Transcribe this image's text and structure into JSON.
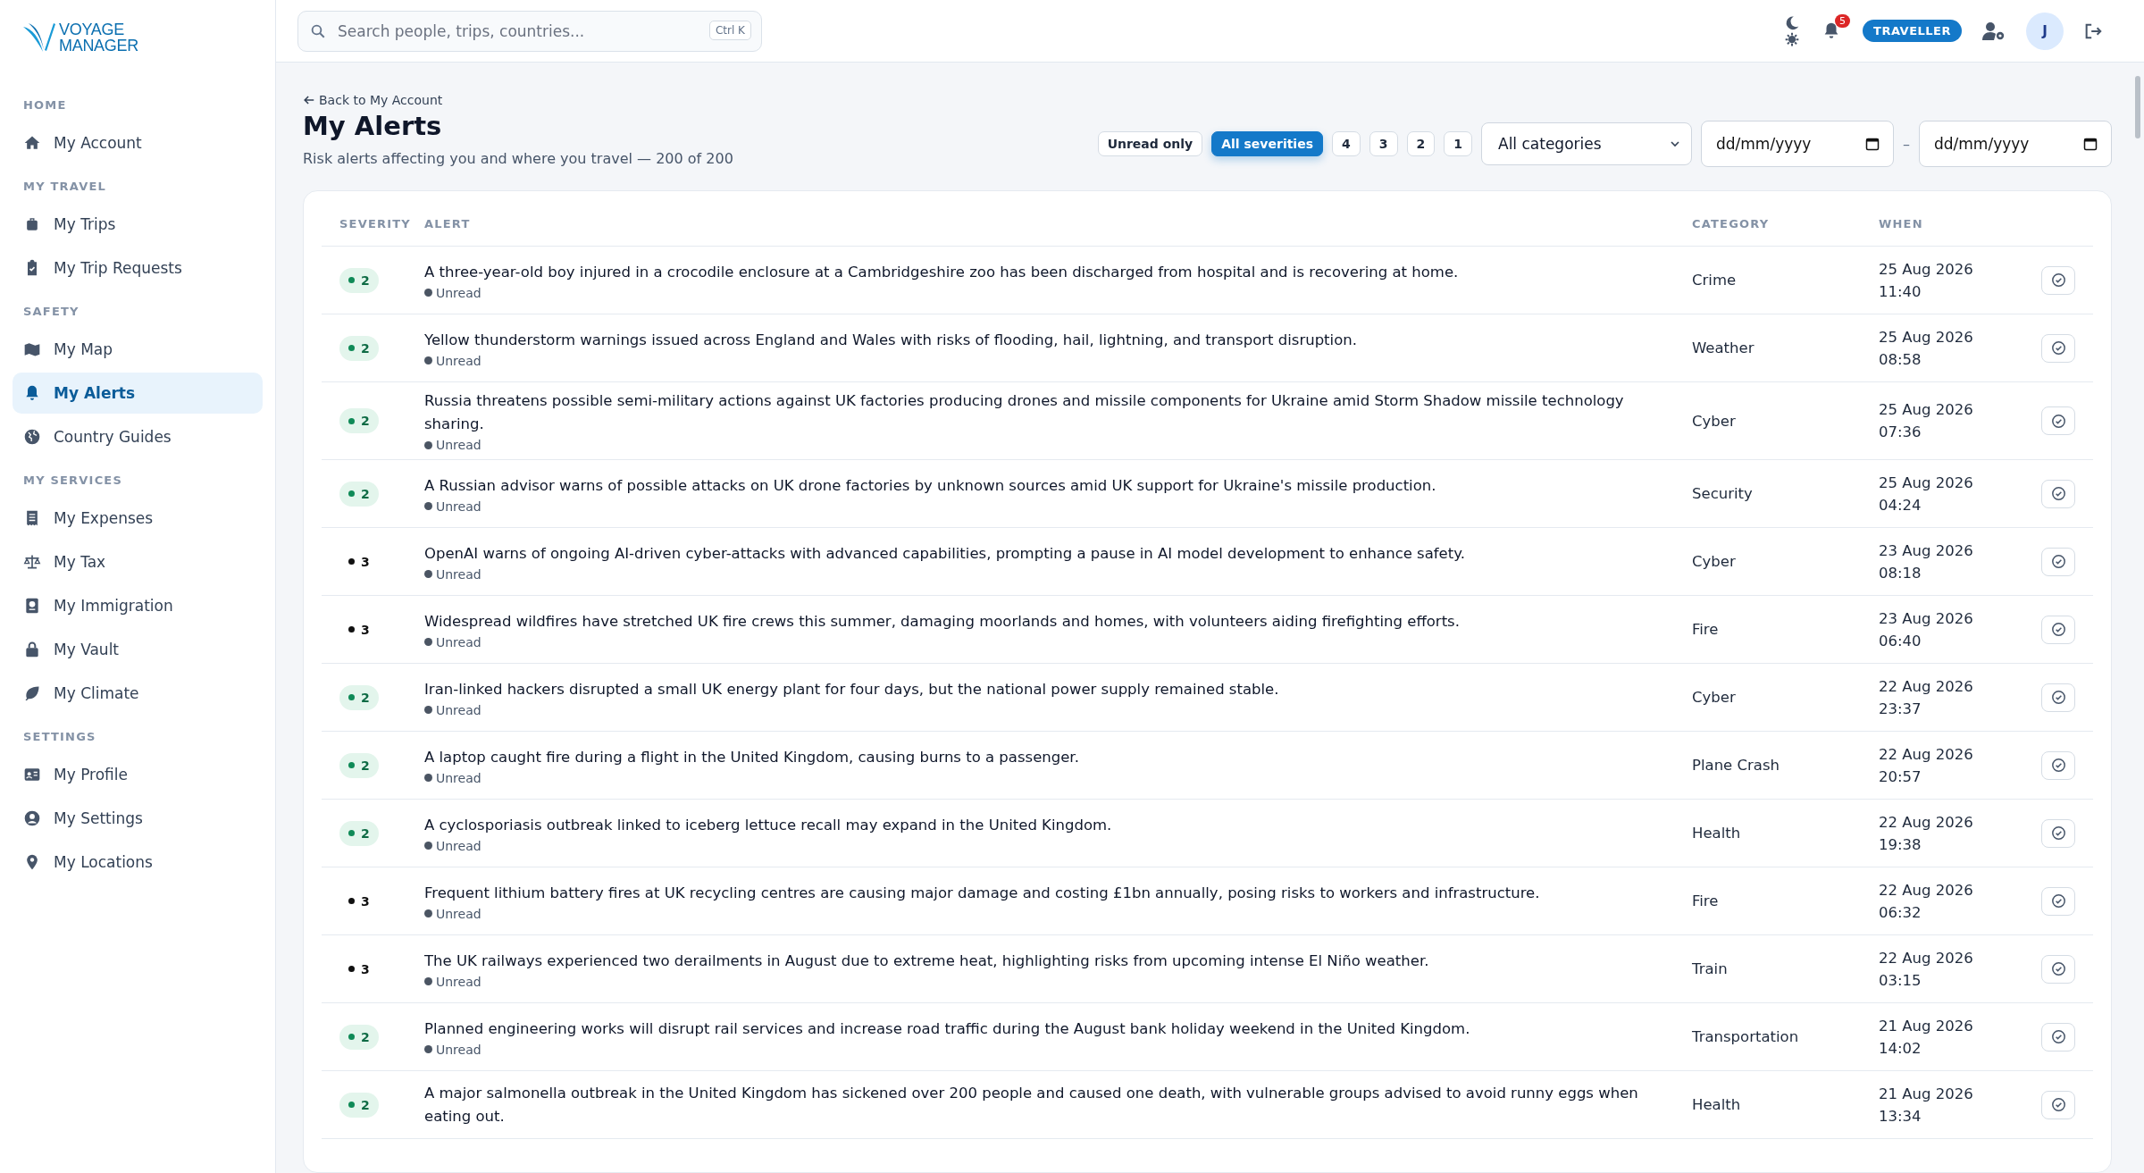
{
  "logo": {
    "line_1": "VOYAGE",
    "line_2": "MANAGER"
  },
  "sidebar": {
    "sections": [
      {
        "heading": "HOME",
        "items": [
          {
            "label": "My Account",
            "selected": false
          }
        ]
      },
      {
        "heading": "MY TRAVEL",
        "items": [
          {
            "label": "My Trips",
            "selected": false
          },
          {
            "label": "My Trip Requests",
            "selected": false
          }
        ]
      },
      {
        "heading": "SAFETY",
        "items": [
          {
            "label": "My Map",
            "selected": false
          },
          {
            "label": "My Alerts",
            "selected": true
          },
          {
            "label": "Country Guides",
            "selected": false
          }
        ]
      },
      {
        "heading": "MY SERVICES",
        "items": [
          {
            "label": "My Expenses",
            "selected": false
          },
          {
            "label": "My Tax",
            "selected": false
          },
          {
            "label": "My Immigration",
            "selected": false
          },
          {
            "label": "My Vault",
            "selected": false
          },
          {
            "label": "My Climate",
            "selected": false
          }
        ]
      },
      {
        "heading": "SETTINGS",
        "items": [
          {
            "label": "My Profile",
            "selected": false
          },
          {
            "label": "My Settings",
            "selected": false
          },
          {
            "label": "My Locations",
            "selected": false
          }
        ]
      }
    ]
  },
  "topbar": {
    "search": {
      "placeholder": "Search people, trips, countries...",
      "shortcut": "Ctrl K"
    },
    "notification_count": "5",
    "role_badge": "TRAVELLER",
    "avatar": "J"
  },
  "header": {
    "back_link": "Back to My Account",
    "title": "My Alerts",
    "subtitle": "Risk alerts affecting you and where you travel — 200 of 200"
  },
  "filters": {
    "chips": [
      {
        "label": "Unread only",
        "selected": false
      },
      {
        "label": "All severities",
        "selected": true
      },
      {
        "label": "4",
        "selected": false
      },
      {
        "label": "3",
        "selected": false
      },
      {
        "label": "2",
        "selected": false
      },
      {
        "label": "1",
        "selected": false
      }
    ],
    "category": "All categories",
    "date_from": {
      "placeholder": "dd/mm/yyyy"
    },
    "date_separator": "–",
    "date_to": {
      "placeholder": "dd/mm/yyyy"
    }
  },
  "table": {
    "columns": [
      "SEVERITY",
      "ALERT",
      "CATEGORY",
      "WHEN"
    ],
    "rows": [
      {
        "severity": "2",
        "kind": "pill",
        "alert": "A three-year-old boy injured in a crocodile enclosure at a Cambridgeshire zoo has been discharged from hospital and is recovering at home.",
        "status": "Unread",
        "category": "Crime",
        "when": "25 Aug 2026 11:40"
      },
      {
        "severity": "2",
        "kind": "pill",
        "alert": "Yellow thunderstorm warnings issued across England and Wales with risks of flooding, hail, lightning, and transport disruption.",
        "status": "Unread",
        "category": "Weather",
        "when": "25 Aug 2026 08:58"
      },
      {
        "severity": "2",
        "kind": "pill",
        "alert": "Russia threatens possible semi-military actions against UK factories producing drones and missile components for Ukraine amid Storm Shadow missile technology sharing.",
        "status": "Unread",
        "category": "Cyber",
        "when": "25 Aug 2026 07:36"
      },
      {
        "severity": "2",
        "kind": "pill",
        "alert": "A Russian advisor warns of possible attacks on UK drone factories by unknown sources amid UK support for Ukraine's missile production.",
        "status": "Unread",
        "category": "Security",
        "when": "25 Aug 2026 04:24"
      },
      {
        "severity": "3",
        "kind": "plain",
        "alert": "OpenAI warns of ongoing AI-driven cyber-attacks with advanced capabilities, prompting a pause in AI model development to enhance safety.",
        "status": "Unread",
        "category": "Cyber",
        "when": "23 Aug 2026 08:18"
      },
      {
        "severity": "3",
        "kind": "plain",
        "alert": "Widespread wildfires have stretched UK fire crews this summer, damaging moorlands and homes, with volunteers aiding firefighting efforts.",
        "status": "Unread",
        "category": "Fire",
        "when": "23 Aug 2026 06:40"
      },
      {
        "severity": "2",
        "kind": "pill",
        "alert": "Iran-linked hackers disrupted a small UK energy plant for four days, but the national power supply remained stable.",
        "status": "Unread",
        "category": "Cyber",
        "when": "22 Aug 2026 23:37"
      },
      {
        "severity": "2",
        "kind": "pill",
        "alert": "A laptop caught fire during a flight in the United Kingdom, causing burns to a passenger.",
        "status": "Unread",
        "category": "Plane Crash",
        "when": "22 Aug 2026 20:57"
      },
      {
        "severity": "2",
        "kind": "pill",
        "alert": "A cyclosporiasis outbreak linked to iceberg lettuce recall may expand in the United Kingdom.",
        "status": "Unread",
        "category": "Health",
        "when": "22 Aug 2026 19:38"
      },
      {
        "severity": "3",
        "kind": "plain",
        "alert": "Frequent lithium battery fires at UK recycling centres are causing major damage and costing £1bn annually, posing risks to workers and infrastructure.",
        "status": "Unread",
        "category": "Fire",
        "when": "22 Aug 2026 06:32"
      },
      {
        "severity": "3",
        "kind": "plain",
        "alert": "The UK railways experienced two derailments in August due to extreme heat, highlighting risks from upcoming intense El Niño weather.",
        "status": "Unread",
        "category": "Train",
        "when": "22 Aug 2026 03:15"
      },
      {
        "severity": "2",
        "kind": "pill",
        "alert": "Planned engineering works will disrupt rail services and increase road traffic during the August bank holiday weekend in the United Kingdom.",
        "status": "Unread",
        "category": "Transportation",
        "when": "21 Aug 2026 14:02"
      },
      {
        "severity": "2",
        "kind": "pill",
        "alert": "A major salmonella outbreak in the United Kingdom has sickened over 200 people and caused one death, with vulnerable groups advised to avoid runny eggs when eating out.",
        "category": "Health",
        "when": "21 Aug 2026 13:34"
      }
    ]
  }
}
